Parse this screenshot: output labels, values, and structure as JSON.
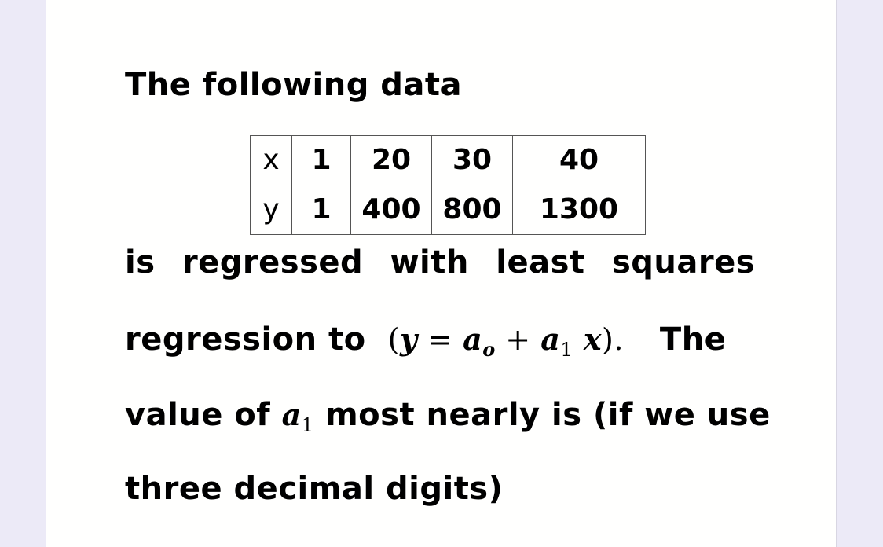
{
  "problem": {
    "intro": "The following data",
    "table": {
      "rows": [
        {
          "label": "x",
          "values": [
            "1",
            "20",
            "30",
            "40"
          ]
        },
        {
          "label": "y",
          "values": [
            "1",
            "400",
            "800",
            "1300"
          ]
        }
      ]
    },
    "line2": "is regressed with least squares",
    "line3_prefix": "regression to",
    "equation": {
      "open": "(",
      "y": "y",
      "eq": " = ",
      "a0": "a",
      "a0_sub": "o",
      "plus": " + ",
      "a1": "a",
      "a1_sub": "1",
      "x": " x",
      "close": ").",
      "after": "The"
    },
    "line4_prefix": "value of",
    "line4_var": "a",
    "line4_var_sub": "1",
    "line4_suffix": "most nearly is (if we use",
    "line5": "three decimal digits)"
  }
}
